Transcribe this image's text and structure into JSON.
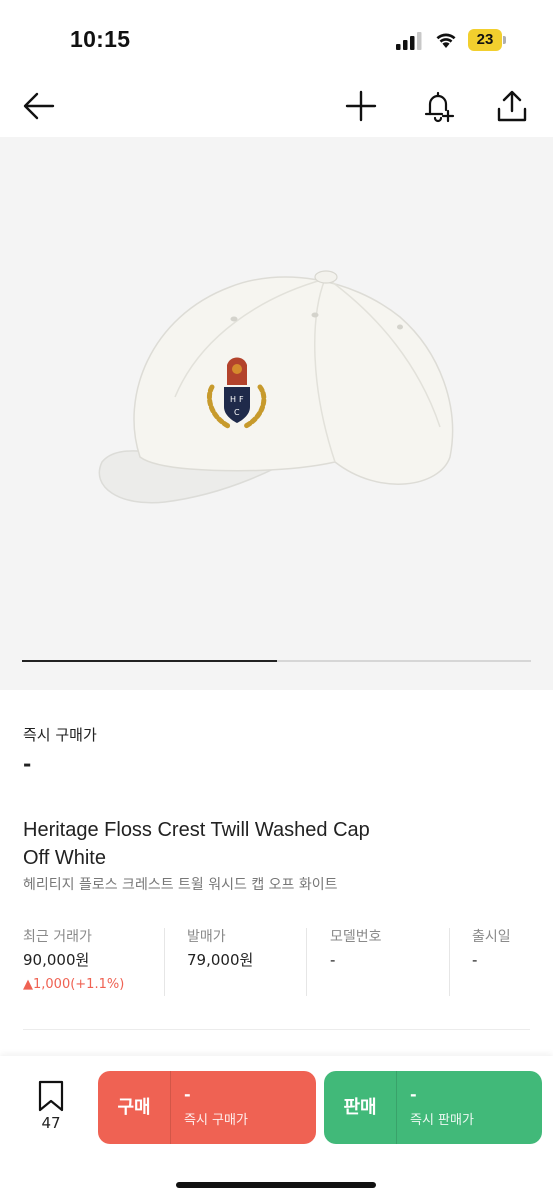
{
  "status_bar": {
    "time": "10:15",
    "battery": "23",
    "battery_color": "#f2cf2e"
  },
  "nav": {
    "back_icon": "arrow-left-icon",
    "add_icon": "plus-icon",
    "alert_icon": "bell-plus-icon",
    "share_icon": "share-icon"
  },
  "gallery": {
    "image": "off-white-baseball-cap-with-crest",
    "progress": 0.5
  },
  "price": {
    "label": "즉시 구매가",
    "value": "-"
  },
  "product": {
    "name_en_line1": "Heritage Floss Crest Twill Washed Cap",
    "name_en_line2": "Off White",
    "name_ko": "헤리티지 플로스 크레스트 트윌 워시드 캡 오프 화이트"
  },
  "info": [
    {
      "label": "최근 거래가",
      "value": "90,000원",
      "change": "▲1,000(+1.1%)"
    },
    {
      "label": "발매가",
      "value": "79,000원"
    },
    {
      "label": "모델번호",
      "value": "-"
    },
    {
      "label": "출시일",
      "value": "-"
    }
  ],
  "bottom": {
    "bookmark_count": "47",
    "buy": {
      "label": "구매",
      "price": "-",
      "sub": "즉시 구매가",
      "color": "#ef6253"
    },
    "sell": {
      "label": "판매",
      "price": "-",
      "sub": "즉시 판매가",
      "color": "#41b979"
    }
  },
  "colors": {
    "price_up": "#ef6253"
  }
}
